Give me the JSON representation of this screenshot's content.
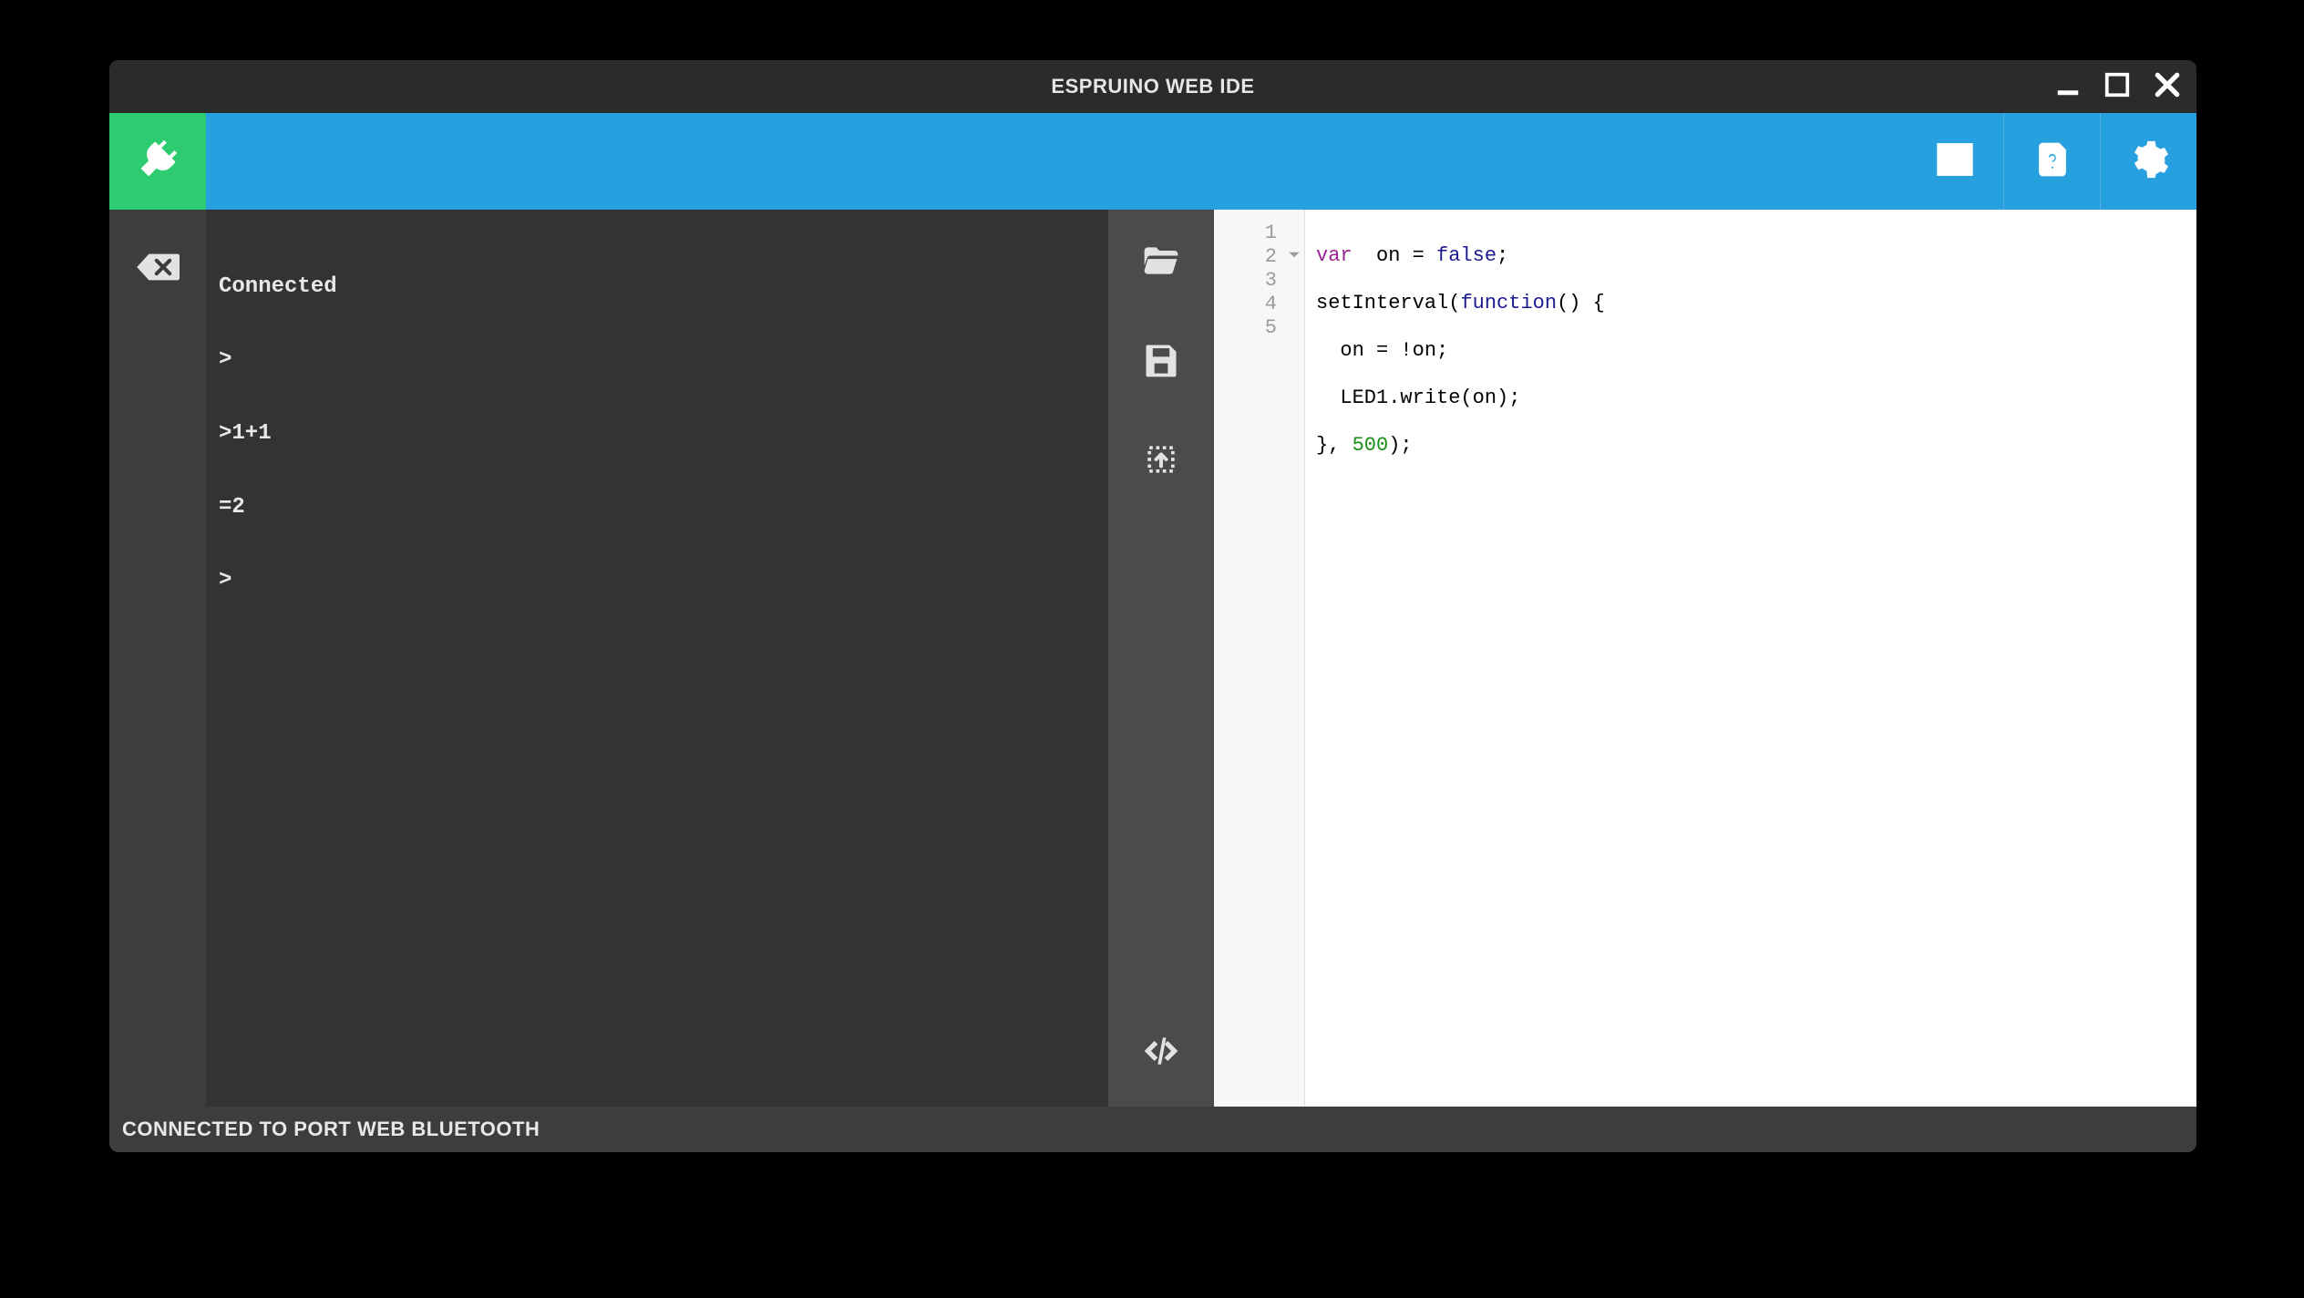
{
  "window": {
    "title": "ESPRUINO WEB IDE"
  },
  "terminal": {
    "lines": [
      "Connected",
      ">",
      ">1+1",
      "=2",
      ">"
    ]
  },
  "editor": {
    "gutter": [
      {
        "n": "1",
        "fold": false
      },
      {
        "n": "2",
        "fold": true
      },
      {
        "n": "3",
        "fold": false
      },
      {
        "n": "4",
        "fold": false
      },
      {
        "n": "5",
        "fold": false
      }
    ],
    "code": {
      "l1": {
        "a": "var",
        "b": "  on = ",
        "c": "false",
        "d": ";"
      },
      "l2": {
        "a": "setInterval(",
        "b": "function",
        "c": "() {"
      },
      "l3": {
        "a": "  on = !on;"
      },
      "l4": {
        "a": "  LED1.write(on);"
      },
      "l5": {
        "a": "}, ",
        "b": "500",
        "c": ");"
      }
    }
  },
  "status": {
    "text": "CONNECTED TO PORT WEB BLUETOOTH"
  },
  "colors": {
    "accent": "#26a0df",
    "connect": "#2ecc71",
    "panel_dark": "#3d3d3d",
    "terminal_bg": "#333333",
    "mid_strip": "#4b4b4b"
  },
  "icons": {
    "connect": "plug-icon",
    "clear": "backspace-icon",
    "open": "folder-open-icon",
    "save": "save-icon",
    "upload": "chip-upload-icon",
    "toggle_code": "code-icon",
    "split": "split-view-icon",
    "help": "help-book-icon",
    "settings": "gear-icon",
    "win_min": "minimize-icon",
    "win_max": "maximize-icon",
    "win_close": "close-icon"
  }
}
